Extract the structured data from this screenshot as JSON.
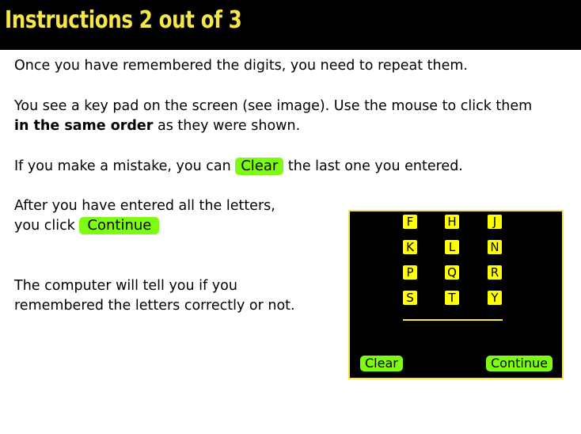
{
  "header": {
    "title": "Instructions 2 out of 3"
  },
  "content": {
    "p1": "Once you have remembered the digits, you need to repeat them.",
    "p2_line1": "You see a key pad on the screen (see image). Use the mouse to click them",
    "p2_bold": "in the same order",
    "p2_rest": " as they were shown.",
    "p3_before": "If you make a mistake, you can ",
    "p3_button": "Clear",
    "p3_after": " the last one you entered.",
    "p4_line1": "After you have entered all the letters,",
    "p4_line2": "you click ",
    "p4_button": "Continue",
    "p5_line1": "The computer will tell you if you",
    "p5_line2": "remembered the letters correctly or not."
  },
  "keypad": {
    "keys": [
      "F",
      "H",
      "J",
      "K",
      "L",
      "N",
      "P",
      "Q",
      "R",
      "S",
      "T",
      "Y"
    ],
    "clear_label": "Clear",
    "continue_label": "Continue"
  },
  "colors": {
    "header_bg": "#000000",
    "title": "#f5e64a",
    "button_green": "#7dfc12",
    "key_yellow": "#ffff00"
  }
}
